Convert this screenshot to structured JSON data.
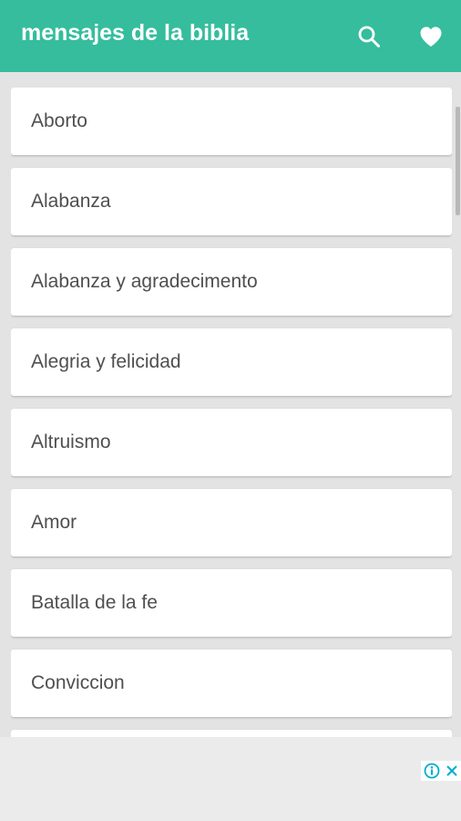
{
  "toolbar": {
    "title": "mensajes de la biblia",
    "search_icon": "search-icon",
    "favorite_icon": "heart-icon",
    "color": "#35bd9d"
  },
  "list": {
    "items": [
      {
        "label": "Aborto"
      },
      {
        "label": "Alabanza"
      },
      {
        "label": "Alabanza y agradecimento"
      },
      {
        "label": "Alegria y felicidad"
      },
      {
        "label": "Altruismo"
      },
      {
        "label": "Amor"
      },
      {
        "label": "Batalla de la fe"
      },
      {
        "label": "Conviccion"
      },
      {
        "label": ""
      }
    ]
  },
  "ad": {
    "info_icon": "info-icon",
    "close_icon": "close-icon",
    "accent": "#00aecd"
  }
}
